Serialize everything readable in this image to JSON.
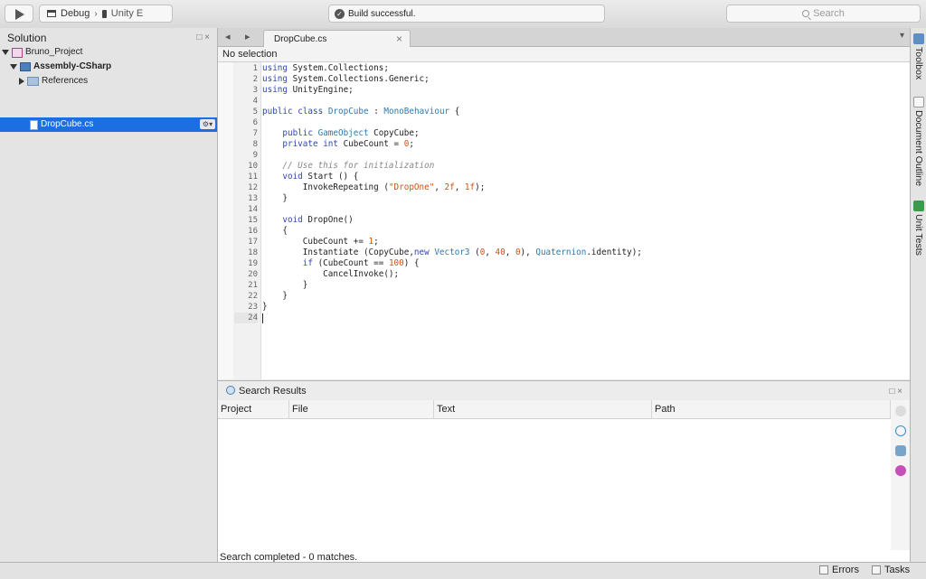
{
  "toolbar": {
    "configuration": "Debug",
    "target": "Unity E",
    "status": "Build successful.",
    "search_placeholder": "Search"
  },
  "solution": {
    "title": "Solution",
    "pad_controls": "□ ×",
    "items": [
      {
        "label": "Bruno_Project",
        "icon": "solution-icon"
      },
      {
        "label": "Assembly-CSharp",
        "icon": "assembly-icon"
      },
      {
        "label": "References",
        "icon": "folder-icon"
      },
      {
        "label": "DropCube.cs",
        "icon": "file-icon"
      }
    ],
    "gear": "⚙▾"
  },
  "editor": {
    "tab_label": "DropCube.cs",
    "tab_close": "×",
    "nav_back": "◂",
    "nav_forward": "▸",
    "tab_menu": "▾",
    "breadcrumb": "No selection",
    "line_numbers": [
      "1",
      "2",
      "3",
      "4",
      "5",
      "6",
      "7",
      "8",
      "9",
      "10",
      "11",
      "12",
      "13",
      "14",
      "15",
      "16",
      "17",
      "18",
      "19",
      "20",
      "21",
      "22",
      "23",
      "24"
    ],
    "code": [
      "using System.Collections;",
      "using System.Collections.Generic;",
      "using UnityEngine;",
      "",
      "public class DropCube : MonoBehaviour {",
      "",
      "    public GameObject CopyCube;",
      "    private int CubeCount = 0;",
      "",
      "    // Use this for initialization",
      "    void Start () {",
      "        InvokeRepeating (\"DropOne\", 2f, 1f);",
      "    }",
      "",
      "    void DropOne()",
      "    {",
      "        CubeCount += 1;",
      "        Instantiate (CopyCube,new Vector3 (0, 40, 0), Quaternion.identity);",
      "        if (CubeCount == 100) {",
      "            CancelInvoke();",
      "        }",
      "    }",
      "}",
      ""
    ]
  },
  "search_results": {
    "title": "Search Results",
    "pad_controls": "□ ×",
    "columns": [
      "Project",
      "File",
      "Text",
      "Path"
    ],
    "status": "Search completed - 0 matches."
  },
  "right_dock": {
    "tabs": [
      {
        "label": "Toolbox",
        "icon": "toolbox-icon"
      },
      {
        "label": "Document Outline",
        "icon": "document-outline-icon"
      },
      {
        "label": "Unit Tests",
        "icon": "unit-tests-icon"
      }
    ]
  },
  "statusbar": {
    "errors": "Errors",
    "tasks": "Tasks"
  },
  "colors": {
    "selection": "#1c6ee1",
    "keyword": "#2f45b5",
    "type": "#2a7ab0",
    "literal": "#d14f14",
    "comment": "#888888"
  }
}
